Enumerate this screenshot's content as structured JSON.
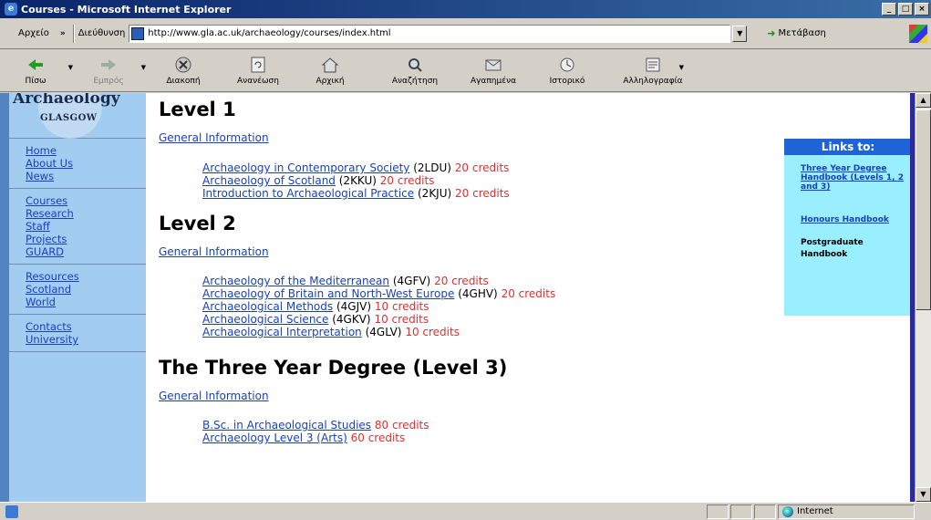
{
  "window": {
    "title": "Courses - Microsoft Internet Explorer",
    "buttons": [
      "_",
      "□",
      "×"
    ]
  },
  "addressbar": {
    "menu_label": "Αρχείο",
    "chevron": "»",
    "address_label": "Διεύθυνση",
    "url": "http://www.gla.ac.uk/archaeology/courses/index.html",
    "go_label": "Μετάβαση"
  },
  "toolbar": {
    "back": "Πίσω",
    "forward": "Εμπρός",
    "stop": "Διακοπή",
    "refresh": "Ανανέωση",
    "home": "Αρχική",
    "search": "Αναζήτηση",
    "favorites": "Αγαπημένα",
    "history": "Ιστορικό",
    "mail": "Αλληλογραφία"
  },
  "sidebar": {
    "logo_top": "Archaeology",
    "logo_bottom": "GLASGOW",
    "groups": [
      [
        "Home",
        "About Us",
        "News"
      ],
      [
        "Courses",
        "Research",
        "Staff",
        "Projects",
        "GUARD"
      ],
      [
        "Resources",
        "Scotland",
        "World"
      ],
      [
        "Contacts",
        "University"
      ]
    ]
  },
  "content": {
    "sections": [
      {
        "heading": "Level 1",
        "general": "General Information",
        "courses": [
          {
            "name": "Archaeology in Contemporary Society",
            "code": "(2LDU)",
            "credits": "20 credits"
          },
          {
            "name": "Archaeology of Scotland",
            "code": "(2KKU)",
            "credits": "20 credits"
          },
          {
            "name": "Introduction to Archaeological Practice",
            "code": "(2KJU)",
            "credits": "20 credits"
          }
        ]
      },
      {
        "heading": "Level 2",
        "general": "General Information",
        "courses": [
          {
            "name": "Archaeology of the Mediterranean",
            "code": "(4GFV)",
            "credits": "20 credits"
          },
          {
            "name": "Archaeology of Britain and North-West Europe",
            "code": "(4GHV)",
            "credits": "20 credits"
          },
          {
            "name": "Archaeological Methods",
            "code": "(4GJV)",
            "credits": "10 credits"
          },
          {
            "name": "Archaeological Science",
            "code": "(4GKV)",
            "credits": "10 credits"
          },
          {
            "name": "Archaeological Interpretation",
            "code": "(4GLV)",
            "credits": "10 credits"
          }
        ]
      },
      {
        "heading": "The Three Year Degree (Level 3)",
        "general": "General Information",
        "courses": [
          {
            "name": "B.Sc. in Archaeological Studies",
            "code": "",
            "credits": "80 credits"
          },
          {
            "name": "Archaeology Level 3 (Arts)",
            "code": "",
            "credits": "60 credits"
          }
        ]
      }
    ]
  },
  "links_box": {
    "title": "Links to:",
    "three_year": "Three Year Degree Handbook (Levels 1, 2 and 3)",
    "honours": "Honours Handbook",
    "postgrad": "Postgraduate Handbook"
  },
  "statusbar": {
    "zone": "Internet"
  },
  "colors": {
    "title_bar": "#0a246a",
    "sidebar_bg": "#a3cdf0",
    "links_bg": "#99eeff",
    "links_title": "#1e64d6",
    "credits": "#e03030",
    "link": "#1a40c0"
  }
}
